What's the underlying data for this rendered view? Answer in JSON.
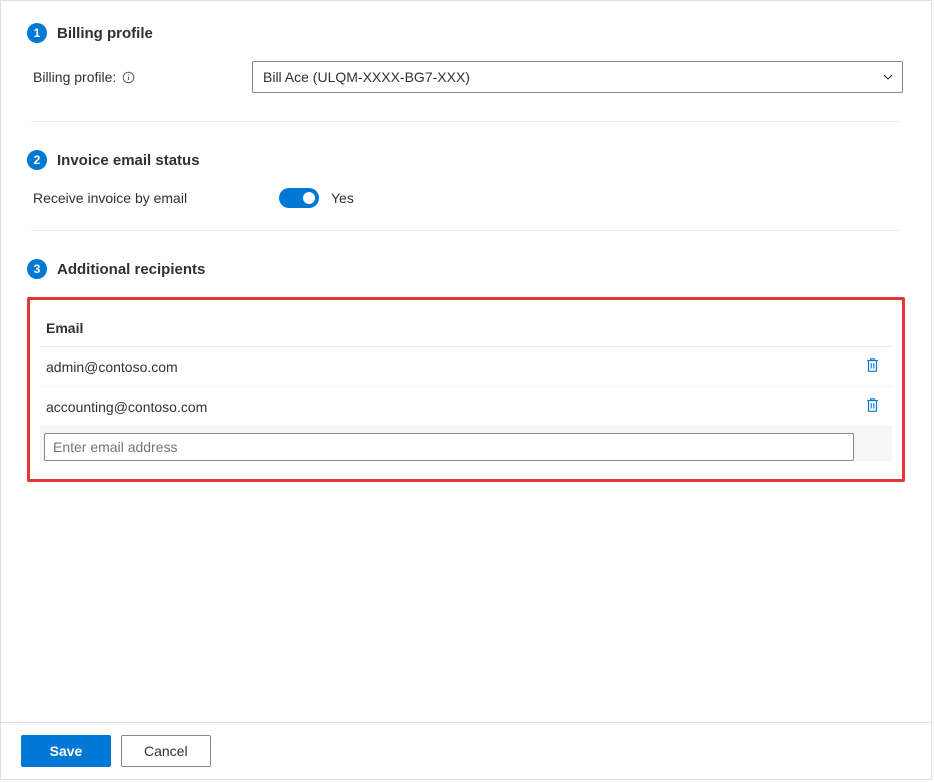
{
  "sections": {
    "billing_profile": {
      "step": "1",
      "title": "Billing profile",
      "field_label": "Billing profile:",
      "selected_value": "Bill Ace (ULQM-XXXX-BG7-XXX)"
    },
    "invoice_email": {
      "step": "2",
      "title": "Invoice email status",
      "toggle_label": "Receive invoice by email",
      "toggle_value": "Yes"
    },
    "recipients": {
      "step": "3",
      "title": "Additional recipients",
      "column_header": "Email",
      "emails": [
        "admin@contoso.com",
        "accounting@contoso.com"
      ],
      "input_placeholder": "Enter email address"
    }
  },
  "footer": {
    "save": "Save",
    "cancel": "Cancel"
  }
}
